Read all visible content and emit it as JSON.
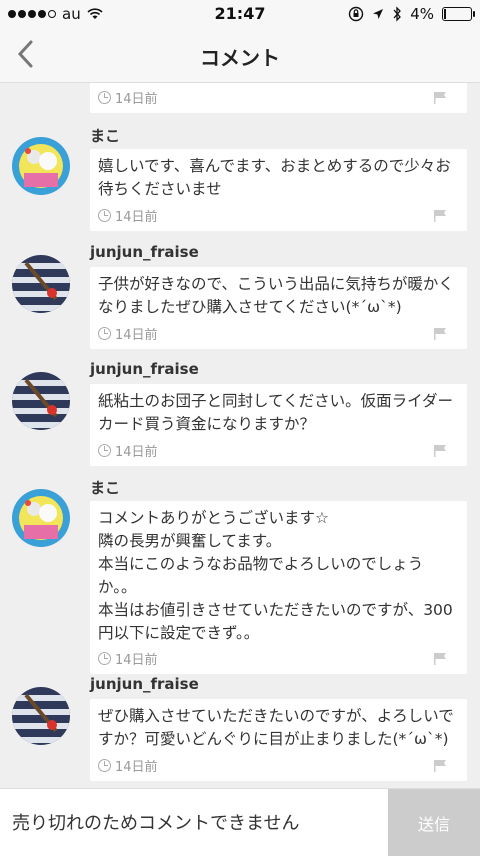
{
  "status_bar": {
    "carrier": "au",
    "time": "21:47",
    "battery": "4%"
  },
  "header": {
    "title": "コメント"
  },
  "comments": [
    {
      "user": "",
      "text": "",
      "time": "14日前"
    },
    {
      "user": "まこ",
      "text": "嬉しいです、喜んでます、おまとめするので少々お待ちくださいませ",
      "time": "14日前"
    },
    {
      "user": "junjun_fraise",
      "text": "子供が好きなので、こういう出品に気持ちが暖かくなりましたぜひ購入させてください(*´ω`*)",
      "time": "14日前"
    },
    {
      "user": "junjun_fraise",
      "text": "紙粘土のお団子と同封してください。仮面ライダーカード買う資金になりますか？",
      "time": "14日前"
    },
    {
      "user": "まこ",
      "text": "コメントありがとうございます☆\n隣の長男が興奮してます。\n本当にこのようなお品物でよろしいのでしょうか。。\n本当はお値引きさせていただきたいのですが、300円以下に設定できず。。",
      "time": "14日前"
    },
    {
      "user": "junjun_fraise",
      "text": "ぜひ購入させていただきたいのですが、よろしいですか？可愛いどんぐりに目が止まりました(*´ω`*)",
      "time": "14日前"
    }
  ],
  "footer": {
    "message": "売り切れのためコメントできません",
    "send_label": "送信"
  },
  "colors": {
    "background": "#efefef",
    "send_disabled": "#cccccc"
  }
}
